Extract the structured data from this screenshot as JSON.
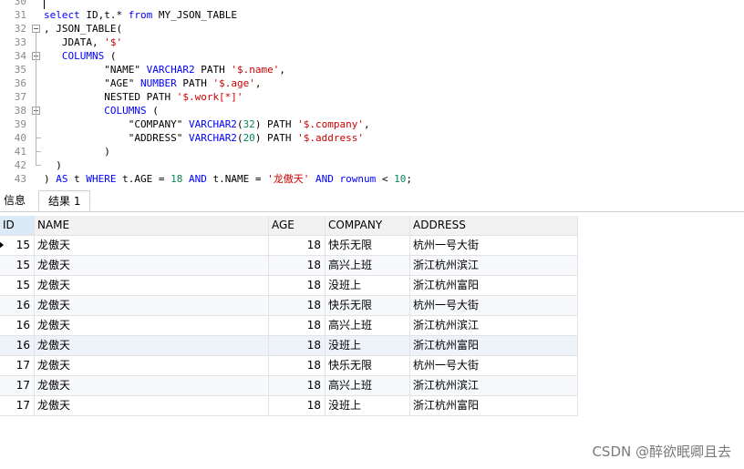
{
  "editor": {
    "lines": [
      {
        "no": "30",
        "tokens": []
      },
      {
        "no": "31",
        "tokens": [
          {
            "t": "select",
            "c": "kw"
          },
          {
            "t": " ID,t.* ",
            "c": "plain"
          },
          {
            "t": "from",
            "c": "kw"
          },
          {
            "t": " MY_JSON_TABLE",
            "c": "plain"
          }
        ]
      },
      {
        "no": "32",
        "tokens": [
          {
            "t": ", JSON_TABLE(",
            "c": "plain"
          }
        ]
      },
      {
        "no": "33",
        "tokens": [
          {
            "t": "   JDATA, ",
            "c": "plain"
          },
          {
            "t": "'$'",
            "c": "str"
          }
        ]
      },
      {
        "no": "34",
        "tokens": [
          {
            "t": "   ",
            "c": "plain"
          },
          {
            "t": "COLUMNS",
            "c": "kw"
          },
          {
            "t": " (",
            "c": "plain"
          }
        ]
      },
      {
        "no": "35",
        "tokens": [
          {
            "t": "          \"NAME\" ",
            "c": "plain"
          },
          {
            "t": "VARCHAR2",
            "c": "kw"
          },
          {
            "t": " PATH ",
            "c": "plain"
          },
          {
            "t": "'$.name'",
            "c": "str"
          },
          {
            "t": ",",
            "c": "plain"
          }
        ]
      },
      {
        "no": "36",
        "tokens": [
          {
            "t": "          \"AGE\" ",
            "c": "plain"
          },
          {
            "t": "NUMBER",
            "c": "kw"
          },
          {
            "t": " PATH ",
            "c": "plain"
          },
          {
            "t": "'$.age'",
            "c": "str"
          },
          {
            "t": ",",
            "c": "plain"
          }
        ]
      },
      {
        "no": "37",
        "tokens": [
          {
            "t": "          NESTED PATH ",
            "c": "plain"
          },
          {
            "t": "'$.work[*]'",
            "c": "str"
          }
        ]
      },
      {
        "no": "38",
        "tokens": [
          {
            "t": "          ",
            "c": "plain"
          },
          {
            "t": "COLUMNS",
            "c": "kw"
          },
          {
            "t": " (",
            "c": "plain"
          }
        ]
      },
      {
        "no": "39",
        "tokens": [
          {
            "t": "              \"COMPANY\" ",
            "c": "plain"
          },
          {
            "t": "VARCHAR2",
            "c": "kw"
          },
          {
            "t": "(",
            "c": "plain"
          },
          {
            "t": "32",
            "c": "num"
          },
          {
            "t": ") PATH ",
            "c": "plain"
          },
          {
            "t": "'$.company'",
            "c": "str"
          },
          {
            "t": ",",
            "c": "plain"
          }
        ]
      },
      {
        "no": "40",
        "tokens": [
          {
            "t": "              \"ADDRESS\" ",
            "c": "plain"
          },
          {
            "t": "VARCHAR2",
            "c": "kw"
          },
          {
            "t": "(",
            "c": "plain"
          },
          {
            "t": "20",
            "c": "num"
          },
          {
            "t": ") PATH ",
            "c": "plain"
          },
          {
            "t": "'$.address'",
            "c": "str"
          }
        ]
      },
      {
        "no": "41",
        "tokens": [
          {
            "t": "          )",
            "c": "plain"
          }
        ]
      },
      {
        "no": "42",
        "tokens": [
          {
            "t": "  )",
            "c": "plain"
          }
        ]
      },
      {
        "no": "43",
        "tokens": [
          {
            "t": ") ",
            "c": "plain"
          },
          {
            "t": "AS",
            "c": "kw"
          },
          {
            "t": " t ",
            "c": "plain"
          },
          {
            "t": "WHERE",
            "c": "kw"
          },
          {
            "t": " t.AGE = ",
            "c": "plain"
          },
          {
            "t": "18",
            "c": "num"
          },
          {
            "t": " ",
            "c": "plain"
          },
          {
            "t": "AND",
            "c": "kw"
          },
          {
            "t": " t.NAME = ",
            "c": "plain"
          },
          {
            "t": "'龙傲天'",
            "c": "str"
          },
          {
            "t": " ",
            "c": "plain"
          },
          {
            "t": "AND",
            "c": "kw"
          },
          {
            "t": " ",
            "c": "plain"
          },
          {
            "t": "rownum",
            "c": "kw"
          },
          {
            "t": " < ",
            "c": "plain"
          },
          {
            "t": "10",
            "c": "num"
          },
          {
            "t": ";",
            "c": "plain"
          }
        ]
      }
    ]
  },
  "tabs": {
    "info_label": "信息",
    "result_label": "结果 1"
  },
  "table": {
    "columns": [
      "ID",
      "NAME",
      "AGE",
      "COMPANY",
      "ADDRESS"
    ],
    "rows": [
      [
        "15",
        "龙傲天",
        "18",
        "快乐无限",
        "杭州一号大街"
      ],
      [
        "15",
        "龙傲天",
        "18",
        "高兴上班",
        "浙江杭州滨江"
      ],
      [
        "15",
        "龙傲天",
        "18",
        "没班上",
        "浙江杭州富阳"
      ],
      [
        "16",
        "龙傲天",
        "18",
        "快乐无限",
        "杭州一号大街"
      ],
      [
        "16",
        "龙傲天",
        "18",
        "高兴上班",
        "浙江杭州滨江"
      ],
      [
        "16",
        "龙傲天",
        "18",
        "没班上",
        "浙江杭州富阳"
      ],
      [
        "17",
        "龙傲天",
        "18",
        "快乐无限",
        "杭州一号大街"
      ],
      [
        "17",
        "龙傲天",
        "18",
        "高兴上班",
        "浙江杭州滨江"
      ],
      [
        "17",
        "龙傲天",
        "18",
        "没班上",
        "浙江杭州富阳"
      ]
    ]
  },
  "watermark": "CSDN @醉欲眠卿且去"
}
